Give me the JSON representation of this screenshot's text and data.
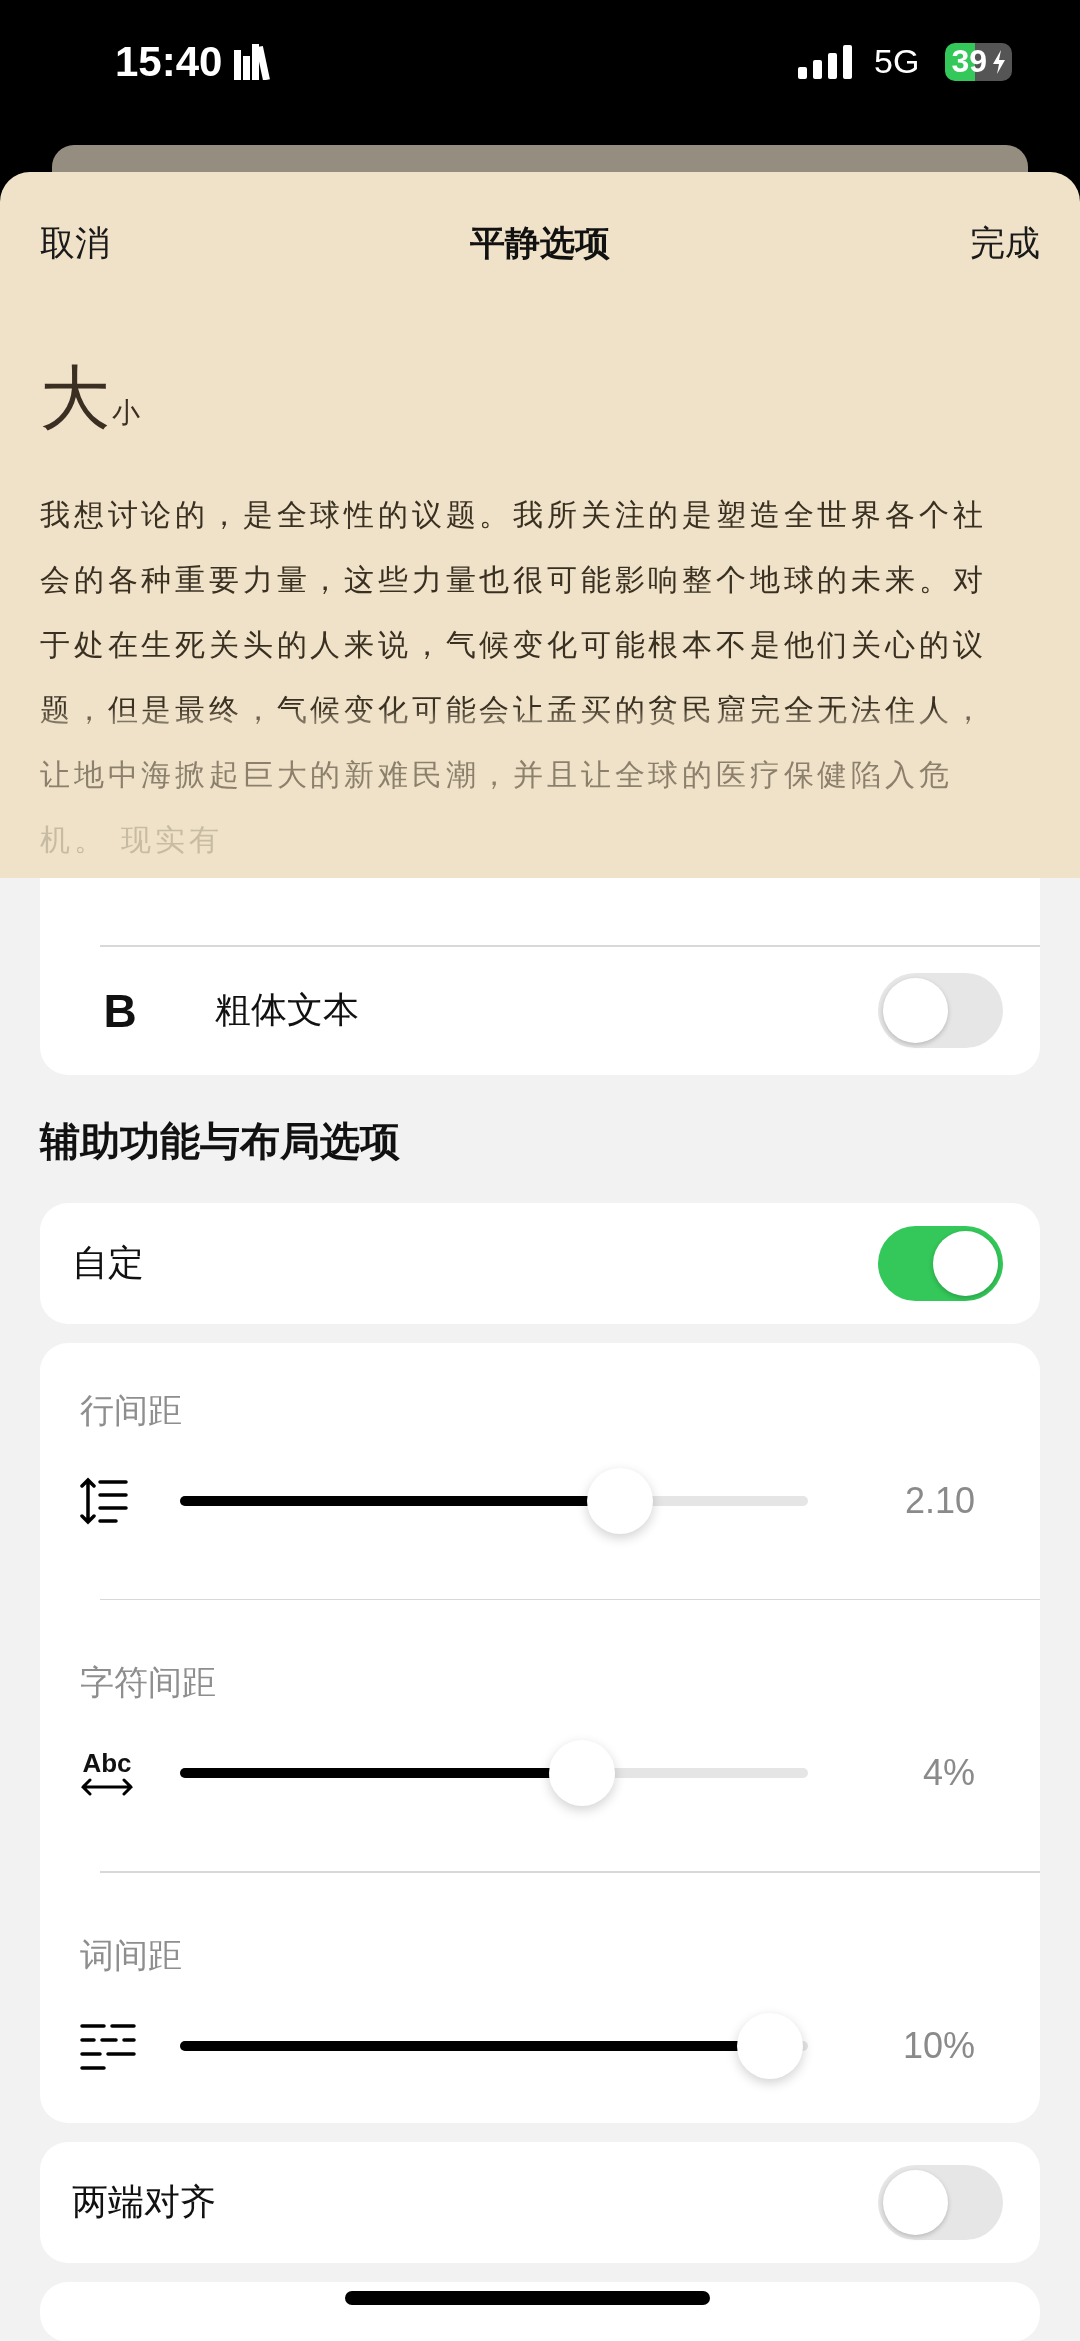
{
  "status_bar": {
    "time": "15:40",
    "network": "5G",
    "battery": "39"
  },
  "sheet": {
    "cancel": "取消",
    "title": "平静选项",
    "done": "完成",
    "preview": {
      "size_large": "大",
      "size_small": "小",
      "paragraph": "我想讨论的，是全球性的议题。我所关注的是塑造全世界各个社会的各种重要力量，这些力量也很可能影响整个地球的未来。对于处在生死关头的人来说，气候变化可能根本不是他们关心的议题，但是最终，气候变化可能会让孟买的贫民窟完全无法住人，让地中海掀起巨大的新难民潮，并且让全球的医疗保健陷入危机。 现实有"
    }
  },
  "bold_text": {
    "icon_label": "B",
    "label": "粗体文本",
    "on": false
  },
  "section_title": "辅助功能与布局选项",
  "custom": {
    "label": "自定",
    "on": true
  },
  "sliders": [
    {
      "kind": "line",
      "label": "行间距",
      "level": 0.7,
      "reading": "2.10"
    },
    {
      "kind": "character",
      "icon_label": "Abc",
      "label": "字符间距",
      "level": 0.64,
      "reading": "4%"
    },
    {
      "kind": "word",
      "label": "词间距",
      "level": 0.94,
      "reading": "10%"
    }
  ],
  "justify": {
    "label": "两端对齐",
    "on": false
  }
}
